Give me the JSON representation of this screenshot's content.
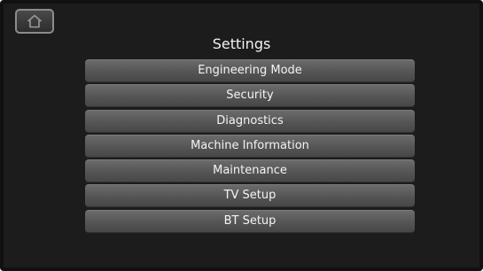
{
  "header": {
    "home_icon": "home-icon",
    "title": "Settings"
  },
  "menu": {
    "items": [
      {
        "label": "Engineering Mode"
      },
      {
        "label": "Security"
      },
      {
        "label": "Diagnostics"
      },
      {
        "label": "Machine Information"
      },
      {
        "label": "Maintenance"
      },
      {
        "label": "TV Setup"
      },
      {
        "label": "BT Setup"
      }
    ]
  },
  "colors": {
    "screen_background": "#1c1c1d",
    "menu_item_background": "#555555",
    "text": "#f2f2f2"
  }
}
